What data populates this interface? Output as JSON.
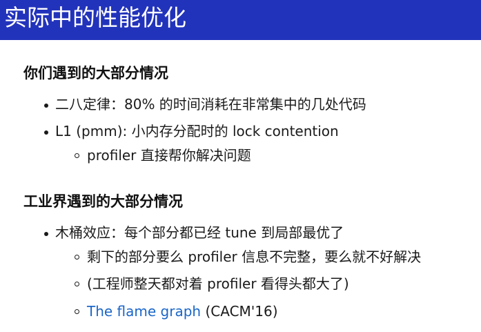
{
  "title": "实际中的性能优化",
  "colors": {
    "title_bar": "#2233bb",
    "title_text": "#ffffff",
    "link": "#1a66c8"
  },
  "sections": [
    {
      "heading": "你们遇到的大部分情况",
      "items": [
        {
          "text": "二八定律：80% 的时间消耗在非常集中的几处代码",
          "level": 1
        },
        {
          "text": "L1 (pmm): 小内存分配时的 lock contention",
          "level": 1
        },
        {
          "text": "profiler 直接帮你解决问题",
          "level": 2
        }
      ]
    },
    {
      "heading": "工业界遇到的大部分情况",
      "items": [
        {
          "text": "木桶效应：每个部分都已经 tune 到局部最优了",
          "level": 1
        },
        {
          "text": "剩下的部分要么 profiler 信息不完整，要么就不好解决",
          "level": 2
        },
        {
          "text": "(工程师整天都对着 profiler 看得头都大了)",
          "level": 2
        },
        {
          "link_text": "The flame graph",
          "suffix": " (CACM'16)",
          "level": 2
        }
      ]
    }
  ]
}
